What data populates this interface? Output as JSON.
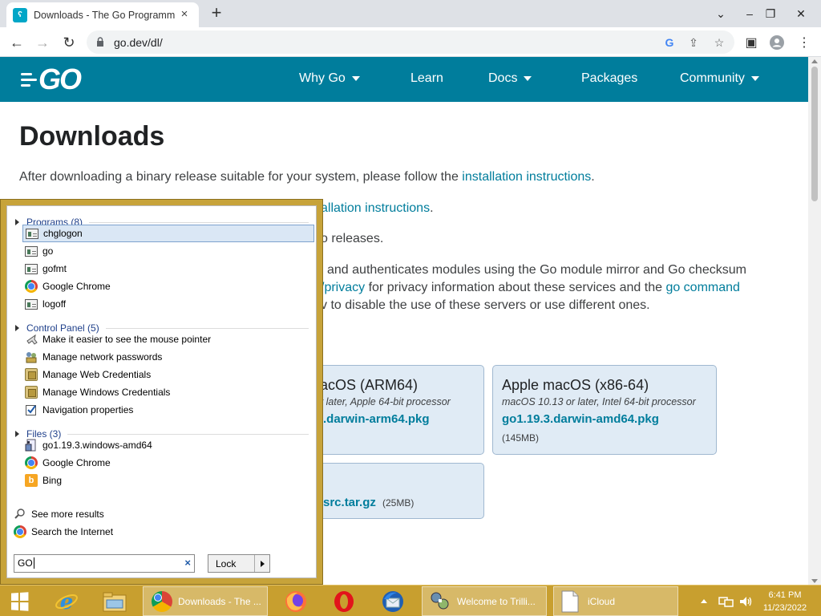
{
  "browser": {
    "tab_title": "Downloads - The Go Programming Language",
    "url": "go.dev/dl/"
  },
  "site": {
    "logo_text": "GO",
    "nav": [
      "Why Go",
      "Learn",
      "Docs",
      "Packages",
      "Community"
    ]
  },
  "page": {
    "heading": "Downloads",
    "line1_pre": "After downloading a binary release suitable for your system, please follow the ",
    "line1_link": "installation instructions",
    "line1_post": ".",
    "line2_link": "allation instructions",
    "line2_post": ".",
    "line3": "o releases.",
    "line4": "and authenticates modules using the Go module mirror and Go checksum",
    "line5_link1": "/privacy",
    "line5_mid": " for privacy information about these services and the ",
    "line5_link2": "go command",
    "line6": "v to disable the use of these servers or use different ones."
  },
  "downloads": {
    "arm": {
      "title": "acOS (ARM64)",
      "sub": "r later, Apple 64-bit processor",
      "file": ".darwin-arm64.pkg"
    },
    "x86": {
      "title": "Apple macOS (x86-64)",
      "sub": "macOS 10.13 or later, Intel 64-bit processor",
      "file": "go1.19.3.darwin-amd64.pkg",
      "size": "(145MB)"
    },
    "src": {
      "file": "src.tar.gz",
      "size": "(25MB)"
    }
  },
  "start_menu": {
    "groups": {
      "programs": "Programs (8)",
      "control_panel": "Control Panel (5)",
      "files": "Files (3)"
    },
    "programs": [
      {
        "label": "chglogon",
        "icon": "program-icon"
      },
      {
        "label": "go",
        "icon": "program-icon"
      },
      {
        "label": "gofmt",
        "icon": "program-icon"
      },
      {
        "label": "Google Chrome",
        "icon": "chrome-icon"
      },
      {
        "label": "logoff",
        "icon": "program-icon"
      }
    ],
    "control_panel": [
      {
        "label": "Make it easier to see the mouse pointer",
        "icon": "mouse-pointer-icon"
      },
      {
        "label": "Manage network passwords",
        "icon": "network-passwords-icon"
      },
      {
        "label": "Manage Web Credentials",
        "icon": "credentials-icon"
      },
      {
        "label": "Manage Windows Credentials",
        "icon": "credentials-icon"
      },
      {
        "label": "Navigation properties",
        "icon": "checkbox-icon"
      }
    ],
    "files": [
      {
        "label": "go1.19.3.windows-amd64",
        "icon": "installer-icon"
      },
      {
        "label": "Google Chrome",
        "icon": "chrome-icon"
      },
      {
        "label": "Bing",
        "icon": "bing-icon"
      }
    ],
    "see_more": "See more results",
    "search_internet": "Search the Internet",
    "search_value": "GO",
    "lock_label": "Lock"
  },
  "taskbar": {
    "chrome_label": "Downloads - The ...",
    "trillian_label": "Welcome to Trilli...",
    "icloud_label": "iCloud",
    "time": "6:41 PM",
    "date": "11/23/2022"
  },
  "colors": {
    "go_blue": "#007d9c",
    "taskbar_gold": "#c89f2f"
  }
}
